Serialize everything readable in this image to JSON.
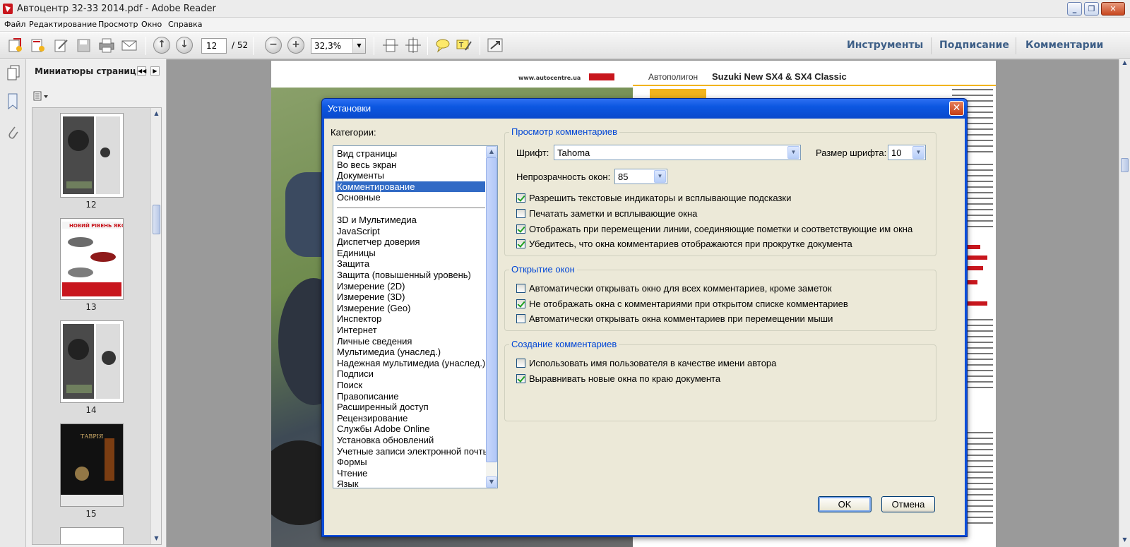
{
  "window": {
    "title": "Автоцентр 32-33 2014.pdf - Adobe Reader"
  },
  "menu": [
    "Файл",
    "Редактирование",
    "Просмотр",
    "Окно",
    "Справка"
  ],
  "toolbar": {
    "page_current": "12",
    "page_total": "/ 52",
    "zoom": "32,3%",
    "links": [
      "Инструменты",
      "Подписание",
      "Комментарии"
    ]
  },
  "thumbnails": {
    "title": "Миниатюры страниц",
    "pages": [
      "12",
      "13",
      "14",
      "15"
    ]
  },
  "document": {
    "left_header": "www.autocentre.ua",
    "right_header_a": "Автополигон",
    "right_header_b": "Suzuki New SX4 & SX4 Classic"
  },
  "dialog": {
    "title": "Установки",
    "categories_label": "Категории:",
    "categories_top": [
      "Вид страницы",
      "Во весь экран",
      "Документы",
      "Комментирование",
      "Основные"
    ],
    "categories_bottom": [
      "3D и Мультимедиа",
      "JavaScript",
      "Диспетчер доверия",
      "Единицы",
      "Защита",
      "Защита (повышенный уровень)",
      "Измерение (2D)",
      "Измерение (3D)",
      "Измерение (Geo)",
      "Инспектор",
      "Интернет",
      "Личные сведения",
      "Мультимедиа (унаслед.)",
      "Надежная мультимедиа (унаслед.)",
      "Подписи",
      "Поиск",
      "Правописание",
      "Расширенный доступ",
      "Рецензирование",
      "Службы Adobe Online",
      "Установка обновлений",
      "Учетные записи электронной почты",
      "Формы",
      "Чтение",
      "Язык"
    ],
    "selected_category": "Комментирование",
    "view_group": {
      "title": "Просмотр комментариев",
      "font_label": "Шрифт:",
      "font_value": "Tahoma",
      "size_label": "Размер шрифта:",
      "size_value": "10",
      "opacity_label": "Непрозрачность окон:",
      "opacity_value": "85",
      "options": [
        {
          "label": "Разрешить текстовые индикаторы и всплывающие подсказки",
          "checked": true
        },
        {
          "label": "Печатать заметки и всплывающие окна",
          "checked": false
        },
        {
          "label": "Отображать при перемещении линии, соединяющие пометки и соответствующие им окна",
          "checked": true
        },
        {
          "label": "Убедитесь, что окна комментариев отображаются при прокрутке документа",
          "checked": true
        }
      ]
    },
    "open_group": {
      "title": "Открытие окон",
      "options": [
        {
          "label": "Автоматически открывать окно для всех комментариев, кроме заметок",
          "checked": false
        },
        {
          "label": "Не отображать окна с комментариями при открытом списке комментариев",
          "checked": true
        },
        {
          "label": "Автоматически открывать окна комментариев при перемещении мыши",
          "checked": false
        }
      ]
    },
    "create_group": {
      "title": "Создание комментариев",
      "options": [
        {
          "label": "Использовать имя пользователя в качестве имени автора",
          "checked": false
        },
        {
          "label": "Выравнивать новые окна по краю документа",
          "checked": true
        }
      ]
    },
    "ok_label": "OK",
    "cancel_label": "Отмена"
  }
}
